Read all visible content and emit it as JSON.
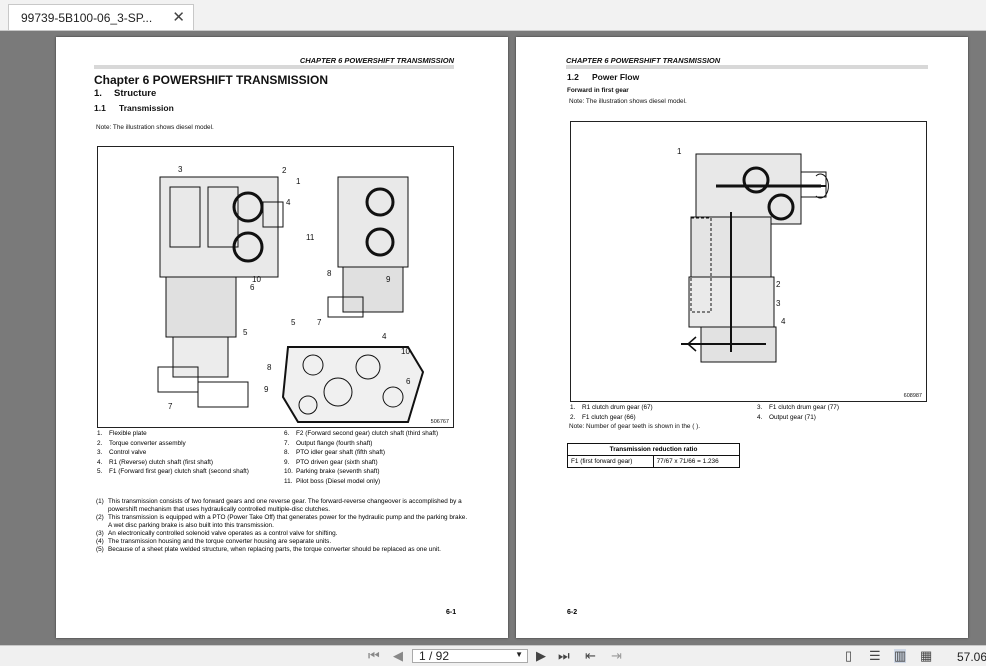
{
  "tab": {
    "title": "99739-5B100-06_3-SP...",
    "close": "✕"
  },
  "left": {
    "header": "CHAPTER 6 POWERSHIFT TRANSMISSION",
    "chapter": "Chapter 6    POWERSHIFT TRANSMISSION",
    "sec_num": "1.",
    "sec_title": "Structure",
    "sub_num": "1.1",
    "sub_title": "Transmission",
    "note": "Note: The illustration shows diesel model.",
    "fig_number": "506767",
    "callouts": [
      "3",
      "2",
      "1",
      "4",
      "11",
      "10",
      "6",
      "5",
      "7",
      "8",
      "9",
      "5",
      "7",
      "4",
      "10",
      "8",
      "9",
      "6"
    ],
    "legend_left": [
      {
        "n": "1.",
        "t": "Flexible plate"
      },
      {
        "n": "2.",
        "t": "Torque converter assembly"
      },
      {
        "n": "3.",
        "t": "Control valve"
      },
      {
        "n": "4.",
        "t": "R1 (Reverse) clutch shaft (first shaft)"
      },
      {
        "n": "5.",
        "t": "F1 (Forward first gear) clutch shaft (second shaft)"
      }
    ],
    "legend_right": [
      {
        "n": "6.",
        "t": "F2 (Forward second gear) clutch shaft (third shaft)"
      },
      {
        "n": "7.",
        "t": "Output flange (fourth shaft)"
      },
      {
        "n": "8.",
        "t": "PTO idler gear shaft (fifth shaft)"
      },
      {
        "n": "9.",
        "t": "PTO driven gear (sixth shaft)"
      },
      {
        "n": "10.",
        "t": "Parking brake (seventh shaft)"
      },
      {
        "n": "11.",
        "t": "Pilot boss (Diesel model only)"
      }
    ],
    "paras": [
      {
        "n": "(1)",
        "t": "This transmission consists of two forward gears and one reverse gear. The forward-reverse changeover is accomplished by a powershift mechanism that uses hydraulically controlled multiple-disc clutches."
      },
      {
        "n": "(2)",
        "t": "This transmission is equipped with a PTO (Power Take Off) that generates power for the hydraulic pump and the parking brake."
      },
      {
        "n": "",
        "t": "A wet disc parking brake is also built into this transmission."
      },
      {
        "n": "(3)",
        "t": "An electronically controlled solenoid valve operates as a control valve for shifting."
      },
      {
        "n": "(4)",
        "t": "The transmission housing and the torque converter housing are separate units."
      },
      {
        "n": "(5)",
        "t": "Because of a sheet plate welded structure, when replacing parts, the torque converter should be replaced as one unit."
      }
    ],
    "page_num": "6-1"
  },
  "right": {
    "header": "CHAPTER 6 POWERSHIFT TRANSMISSION",
    "sec_num": "1.2",
    "sec_title": "Power Flow",
    "subtitle": "Forward in first gear",
    "note": "Note: The illustration shows diesel model.",
    "fig_number": "608987",
    "callouts": [
      "1",
      "2",
      "3",
      "4"
    ],
    "legend_left": [
      {
        "n": "1.",
        "t": "R1 clutch drum gear (67)"
      },
      {
        "n": "2.",
        "t": "F1 clutch gear (66)"
      }
    ],
    "legend_right": [
      {
        "n": "3.",
        "t": "F1 clutch drum gear (77)"
      },
      {
        "n": "4.",
        "t": "Output gear (71)"
      }
    ],
    "teeth_note": "Note: Number of gear teeth is shown in the ( ).",
    "table_title": "Transmission reduction ratio",
    "table_row_label": "F1 (first forward gear)",
    "table_row_value": "77/67 x 71/66 = 1.236",
    "page_num": "6-2"
  },
  "toolbar": {
    "page_indicator": "1 / 92",
    "zoom": "57.06"
  }
}
